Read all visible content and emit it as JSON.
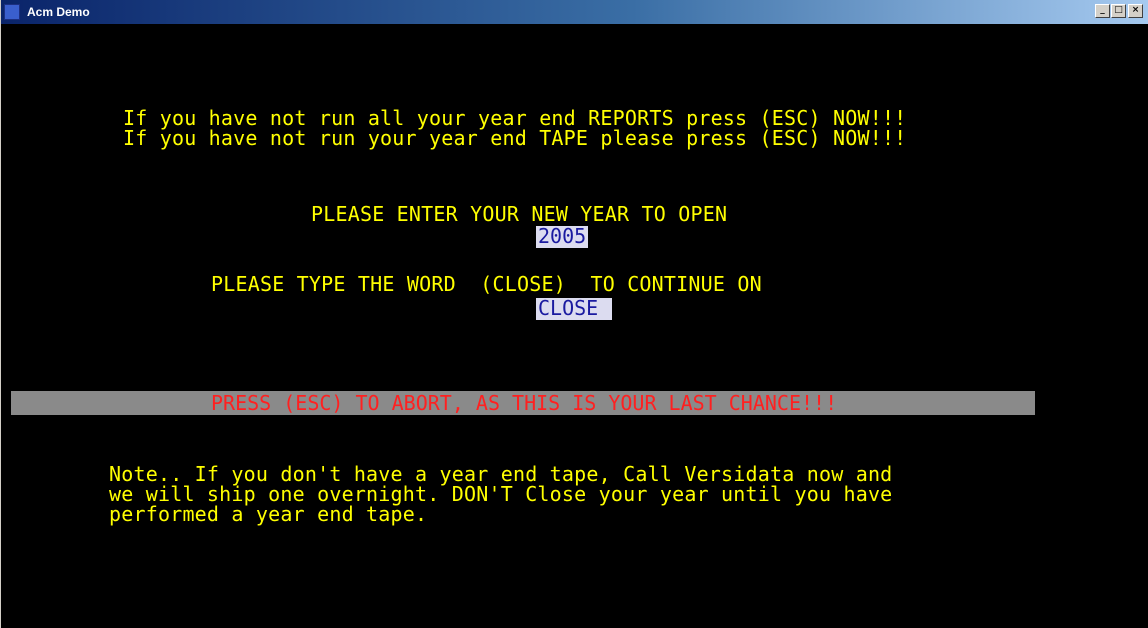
{
  "window": {
    "title": "Acm Demo",
    "icon": "app-icon",
    "buttons": {
      "minimize": "_",
      "maximize": "□",
      "close": "×"
    }
  },
  "warnings": {
    "line1": "If you have not run all your year end REPORTS press (ESC) NOW!!!",
    "line2": "If you have not run your year end TAPE please press (ESC) NOW!!!"
  },
  "year_prompt": {
    "label": "PLEASE ENTER YOUR NEW YEAR TO OPEN",
    "value": "2005"
  },
  "close_prompt": {
    "label": "PLEASE TYPE THE WORD  (CLOSE)  TO CONTINUE ON",
    "value": "CLOSE "
  },
  "abort_bar": {
    "text": "PRESS (ESC) TO ABORT, AS THIS IS YOUR LAST CHANCE!!!"
  },
  "note": {
    "line1": "Note.. If you don't have a year end tape, Call Versidata now and",
    "line2": "we will ship one overnight. DON'T Close your year until you have",
    "line3": "performed a year end tape."
  },
  "colors": {
    "terminal_bg": "#000000",
    "text": "#ffff00",
    "field_bg": "#dcdcf0",
    "field_text": "#1a1aa0",
    "bar_bg": "#8a8a8a",
    "bar_text": "#ff2020"
  }
}
